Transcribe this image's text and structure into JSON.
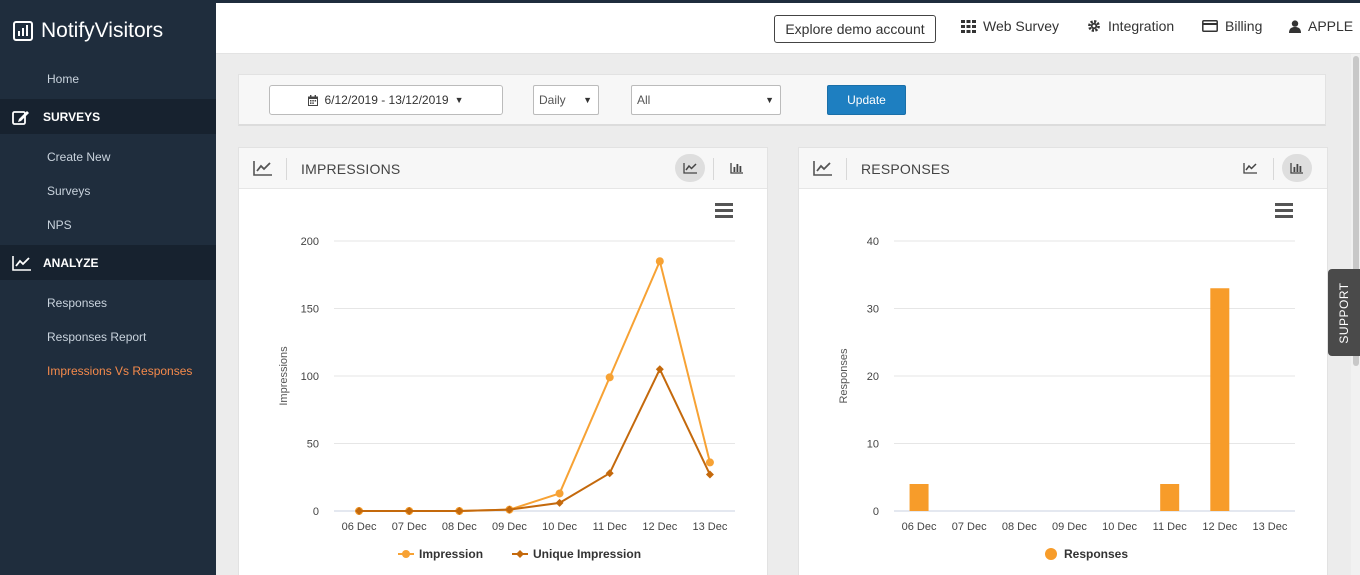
{
  "brand": {
    "name": "NotifyVisitors"
  },
  "sidebar": {
    "home": "Home",
    "surveys_section": "SURVEYS",
    "create_new": "Create New",
    "surveys": "Surveys",
    "nps": "NPS",
    "analyze_section": "ANALYZE",
    "responses": "Responses",
    "responses_report": "Responses Report",
    "impressions_vs_responses": "Impressions Vs Responses"
  },
  "topbar": {
    "explore_demo": "Explore demo account",
    "web_survey": "Web Survey",
    "integration": "Integration",
    "billing": "Billing",
    "user": "APPLE"
  },
  "filters": {
    "date_range": "6/12/2019 - 13/12/2019",
    "interval": "Daily",
    "survey": "All",
    "update": "Update"
  },
  "support": "SUPPORT",
  "colors": {
    "sidebar_bg": "#1f2d3d",
    "accent": "#f58a4b",
    "impression": "#f7a234",
    "unique": "#c4690c",
    "responses": "#f79c2a",
    "button": "#1e7fc1"
  },
  "impressions_panel": {
    "title": "IMPRESSIONS",
    "view": "line"
  },
  "responses_panel": {
    "title": "RESPONSES",
    "view": "bar"
  },
  "chart_data": [
    {
      "type": "line",
      "title": "",
      "ylabel": "Impressions",
      "xlabel": "",
      "categories": [
        "06 Dec",
        "07 Dec",
        "08 Dec",
        "09 Dec",
        "10 Dec",
        "11 Dec",
        "12 Dec",
        "13 Dec"
      ],
      "ylim": [
        0,
        200
      ],
      "yticks": [
        0,
        50,
        100,
        150,
        200
      ],
      "grid": true,
      "legend": "bottom-center",
      "series": [
        {
          "name": "Impression",
          "values": [
            0,
            0,
            0,
            1,
            13,
            99,
            185,
            36
          ],
          "color": "#f7a234",
          "marker": "circle"
        },
        {
          "name": "Unique Impression",
          "values": [
            0,
            0,
            0,
            1,
            6,
            28,
            105,
            27
          ],
          "color": "#c4690c",
          "marker": "diamond"
        }
      ]
    },
    {
      "type": "bar",
      "title": "",
      "ylabel": "Responses",
      "xlabel": "",
      "categories": [
        "06 Dec",
        "07 Dec",
        "08 Dec",
        "09 Dec",
        "10 Dec",
        "11 Dec",
        "12 Dec",
        "13 Dec"
      ],
      "ylim": [
        0,
        40
      ],
      "yticks": [
        0,
        10,
        20,
        30,
        40
      ],
      "grid": true,
      "legend": "bottom-center",
      "series": [
        {
          "name": "Responses",
          "values": [
            4,
            0,
            0,
            0,
            0,
            4,
            33,
            0
          ],
          "color": "#f79c2a"
        }
      ]
    }
  ]
}
